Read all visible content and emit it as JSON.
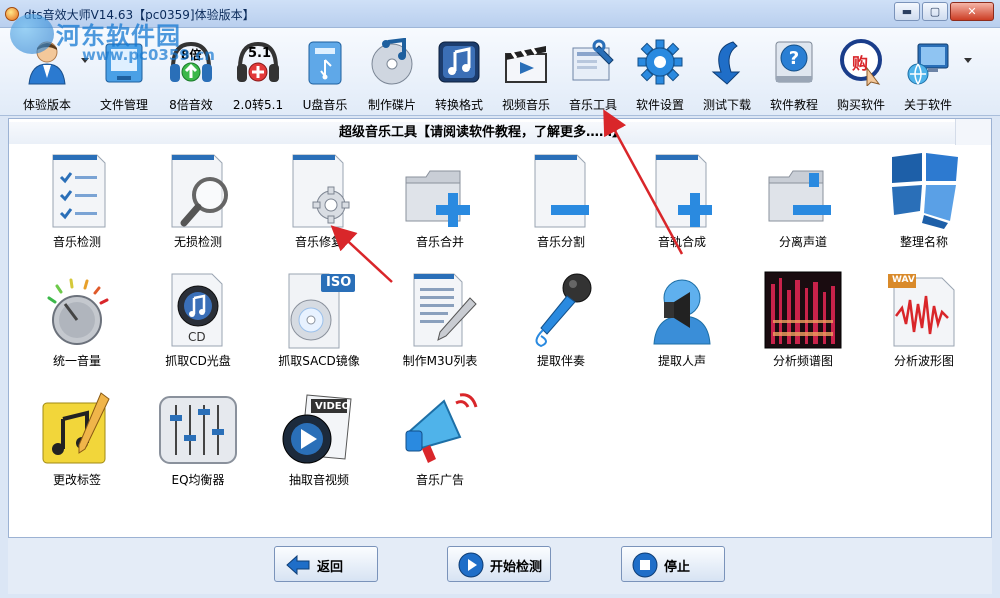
{
  "window": {
    "title": "dts音效大师V14.63【pc0359]体验版本】",
    "buttons": {
      "minimize": "▬",
      "maximize": "▢",
      "close": "✕"
    }
  },
  "watermark": {
    "name": "河东软件园",
    "url": "www.pc0359.cn"
  },
  "toolbar": {
    "items": [
      {
        "label": "体验版本",
        "icon": "user-icon"
      },
      {
        "label": "文件管理",
        "icon": "folder-icon"
      },
      {
        "label": "8倍音效",
        "icon": "headphones-8x-icon",
        "badge": "8倍"
      },
      {
        "label": "2.0转5.1",
        "icon": "headphones-51-icon",
        "badge": "5.1"
      },
      {
        "label": "U盘音乐",
        "icon": "usb-drive-icon"
      },
      {
        "label": "制作碟片",
        "icon": "music-disc-icon"
      },
      {
        "label": "转换格式",
        "icon": "music-note-icon"
      },
      {
        "label": "视频音乐",
        "icon": "clapperboard-icon"
      },
      {
        "label": "音乐工具",
        "icon": "tools-icon"
      },
      {
        "label": "软件设置",
        "icon": "gear-icon"
      },
      {
        "label": "测试下载",
        "icon": "download-arrow-icon"
      },
      {
        "label": "软件教程",
        "icon": "help-book-icon"
      },
      {
        "label": "购买软件",
        "icon": "buy-icon",
        "badge": "购"
      },
      {
        "label": "关于软件",
        "icon": "computer-globe-icon"
      }
    ]
  },
  "main": {
    "title": "超级音乐工具【请阅读软件教程，了解更多……】",
    "tiles": [
      {
        "label": "音乐检测",
        "icon": "checklist-doc-icon"
      },
      {
        "label": "无损检测",
        "icon": "magnifier-doc-icon"
      },
      {
        "label": "音乐修复",
        "icon": "gear-doc-icon"
      },
      {
        "label": "音乐合并",
        "icon": "folder-plus-icon"
      },
      {
        "label": "音乐分割",
        "icon": "doc-minus-icon"
      },
      {
        "label": "音轨合成",
        "icon": "doc-plus-icon"
      },
      {
        "label": "分离声道",
        "icon": "folder-minus-icon"
      },
      {
        "label": "整理名称",
        "icon": "tiles-icon"
      },
      {
        "label": "统一音量",
        "icon": "volume-knob-icon"
      },
      {
        "label": "抓取CD光盘",
        "icon": "cd-doc-icon",
        "badge": "CD"
      },
      {
        "label": "抓取SACD镜像",
        "icon": "iso-disc-icon",
        "badge": "ISO"
      },
      {
        "label": "制作M3U列表",
        "icon": "pen-doc-icon"
      },
      {
        "label": "提取伴奏",
        "icon": "microphone-icon"
      },
      {
        "label": "提取人声",
        "icon": "speaker-person-icon"
      },
      {
        "label": "分析频谱图",
        "icon": "spectrogram-icon"
      },
      {
        "label": "分析波形图",
        "icon": "waveform-icon",
        "badge": "WAV"
      },
      {
        "label": "更改标签",
        "icon": "music-tag-icon"
      },
      {
        "label": "EQ均衡器",
        "icon": "equalizer-icon"
      },
      {
        "label": "抽取音视频",
        "icon": "video-disc-icon",
        "badge": "VIDEO"
      },
      {
        "label": "音乐广告",
        "icon": "megaphone-icon"
      }
    ]
  },
  "footer": {
    "back": "返回",
    "start": "开始检测",
    "stop": "停止"
  },
  "colors": {
    "accent": "#2a6fb8",
    "annotation": "#d9262a"
  }
}
